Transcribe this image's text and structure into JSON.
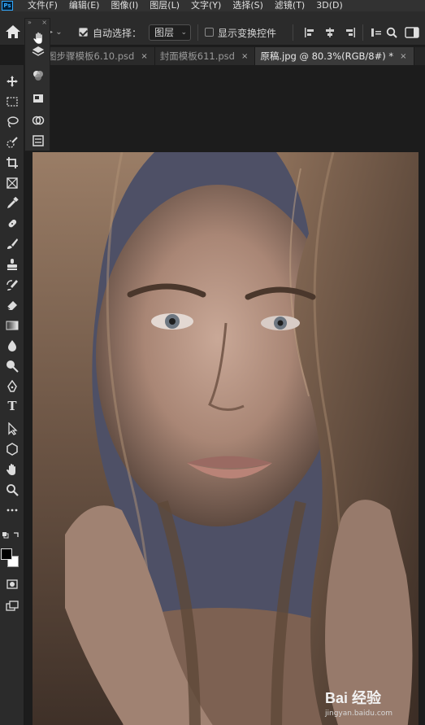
{
  "app": {
    "logo_text": "Ps"
  },
  "menubar": {
    "items": [
      "文件(F)",
      "编辑(E)",
      "图像(I)",
      "图层(L)",
      "文字(Y)",
      "选择(S)",
      "滤镜(T)",
      "3D(D)"
    ]
  },
  "options_bar": {
    "auto_select_label": "自动选择：",
    "auto_select_checked": true,
    "auto_select_target": "图层",
    "show_transform_label": "显示变换控件",
    "show_transform_checked": false
  },
  "tabs": [
    {
      "label": "图步骤模板6.10.psd",
      "close": "×",
      "active": false
    },
    {
      "label": "封面模板611.psd",
      "close": "×",
      "active": false
    },
    {
      "label": "原稿.jpg @ 80.3%(RGB/8#) *",
      "close": "×",
      "active": true
    }
  ],
  "tools": [
    {
      "icon": "move-icon"
    },
    {
      "icon": "marquee-icon"
    },
    {
      "icon": "lasso-icon"
    },
    {
      "icon": "quick-select-icon"
    },
    {
      "icon": "crop-icon"
    },
    {
      "icon": "frame-icon"
    },
    {
      "icon": "eyedropper-icon"
    },
    {
      "icon": "healing-brush-icon"
    },
    {
      "icon": "brush-icon"
    },
    {
      "icon": "stamp-icon"
    },
    {
      "icon": "history-brush-icon"
    },
    {
      "icon": "eraser-icon"
    },
    {
      "icon": "gradient-icon"
    },
    {
      "icon": "blur-icon"
    },
    {
      "icon": "dodge-icon"
    },
    {
      "icon": "pen-icon"
    },
    {
      "icon": "type-tool-icon",
      "glyph": "T"
    },
    {
      "icon": "path-select-icon"
    },
    {
      "icon": "shape-icon"
    },
    {
      "icon": "hand-icon"
    },
    {
      "icon": "zoom-icon"
    },
    {
      "icon": "more-tools-icon"
    }
  ],
  "panel_strip": {
    "icons": [
      "layers-icon",
      "channels-icon",
      "3d-panel-icon",
      "paths-icon",
      "properties-icon"
    ]
  },
  "colors": {
    "foreground": "#000000",
    "background": "#ffffff",
    "accent": "#31a8ff"
  },
  "watermark": {
    "brand": "Bai\t经验",
    "sub": "jingyan.baidu.com"
  }
}
